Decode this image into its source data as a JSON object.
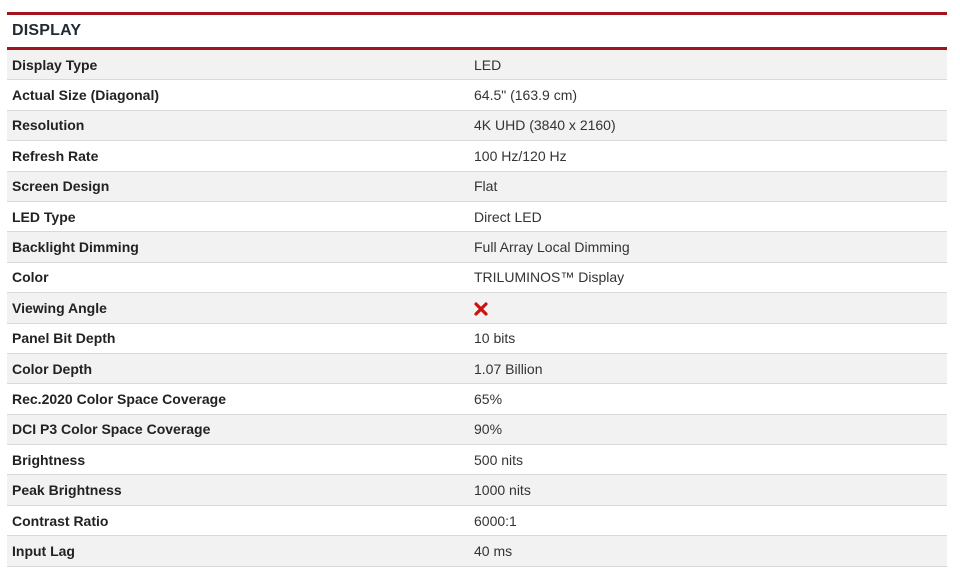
{
  "section": {
    "title": "DISPLAY"
  },
  "colors": {
    "accent": "#a3141c",
    "row_alt": "#f2f2f2",
    "cross": "#cc1111"
  },
  "rows": [
    {
      "label": "Display Type",
      "value": "LED"
    },
    {
      "label": "Actual Size (Diagonal)",
      "value": "64.5\" (163.9 cm)"
    },
    {
      "label": "Resolution",
      "value": "4K UHD (3840 x 2160)"
    },
    {
      "label": "Refresh Rate",
      "value": "100 Hz/120 Hz"
    },
    {
      "label": "Screen Design",
      "value": "Flat"
    },
    {
      "label": "LED Type",
      "value": "Direct LED"
    },
    {
      "label": "Backlight Dimming",
      "value": "Full Array Local Dimming"
    },
    {
      "label": "Color",
      "value": "TRILUMINOS™ Display"
    },
    {
      "label": "Viewing Angle",
      "value": null,
      "icon": "cross-icon"
    },
    {
      "label": "Panel Bit Depth",
      "value": "10 bits"
    },
    {
      "label": "Color Depth",
      "value": "1.07 Billion"
    },
    {
      "label": "Rec.2020 Color Space Coverage",
      "value": "65%"
    },
    {
      "label": "DCI P3 Color Space Coverage",
      "value": "90%"
    },
    {
      "label": "Brightness",
      "value": "500 nits"
    },
    {
      "label": "Peak Brightness",
      "value": "1000 nits"
    },
    {
      "label": "Contrast Ratio",
      "value": "6000:1"
    },
    {
      "label": "Input Lag",
      "value": "40 ms"
    }
  ]
}
